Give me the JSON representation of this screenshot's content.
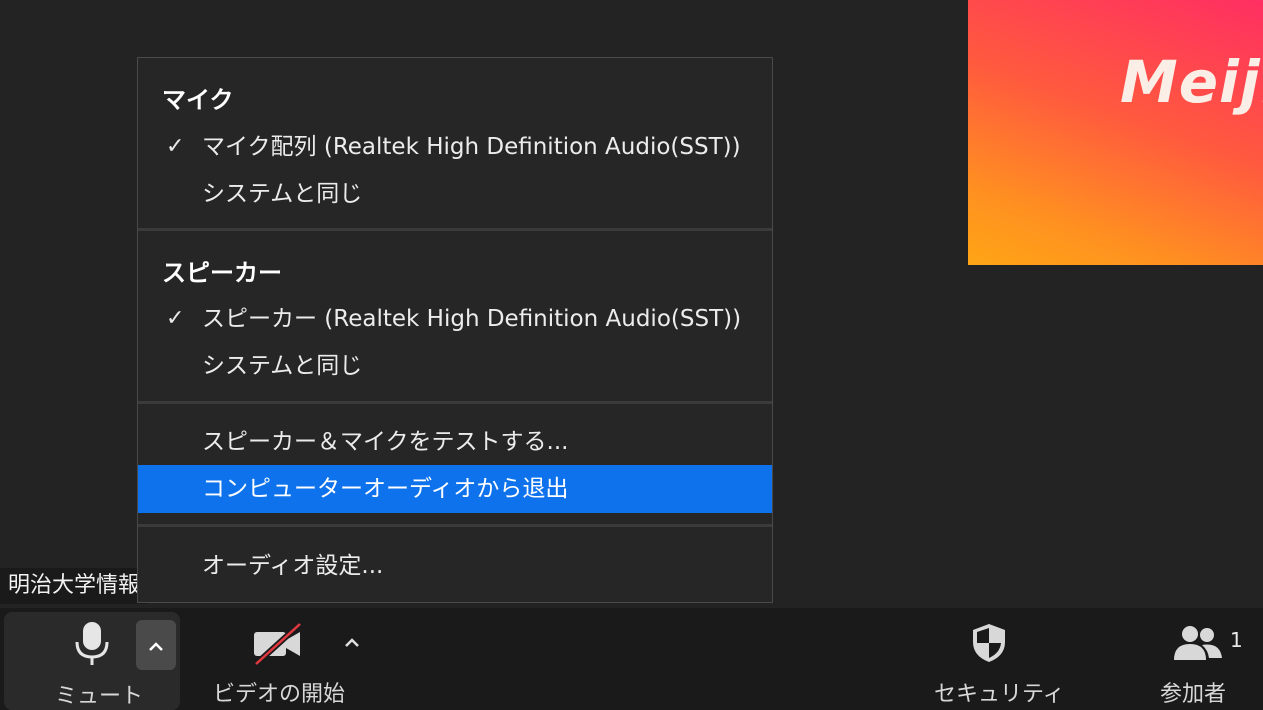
{
  "video": {
    "thumbnail_text": "Meiji",
    "name_tag": "明治大学情報"
  },
  "audio_menu": {
    "mic": {
      "heading": "マイク",
      "items": [
        {
          "label": "マイク配列 (Realtek High Definition Audio(SST))",
          "checked": true
        },
        {
          "label": "システムと同じ",
          "checked": false
        }
      ]
    },
    "speaker": {
      "heading": "スピーカー",
      "items": [
        {
          "label": "スピーカー (Realtek High Definition Audio(SST))",
          "checked": true
        },
        {
          "label": "システムと同じ",
          "checked": false
        }
      ]
    },
    "actions": {
      "test_label": "スピーカー＆マイクをテストする...",
      "leave_label": "コンピューターオーディオから退出"
    },
    "settings_label": "オーディオ設定...",
    "check_glyph": "✓",
    "highlight_color": "#0e72ed"
  },
  "toolbar": {
    "mute_label": "ミュート",
    "video_label": "ビデオの開始",
    "security_label": "セキュリティ",
    "participants_label": "参加者",
    "participants_count": "1",
    "arrow_glyph": "^"
  },
  "icons": [
    "microphone-icon",
    "video-off-icon",
    "shield-icon",
    "participants-icon",
    "chevron-up-icon",
    "check-icon"
  ]
}
